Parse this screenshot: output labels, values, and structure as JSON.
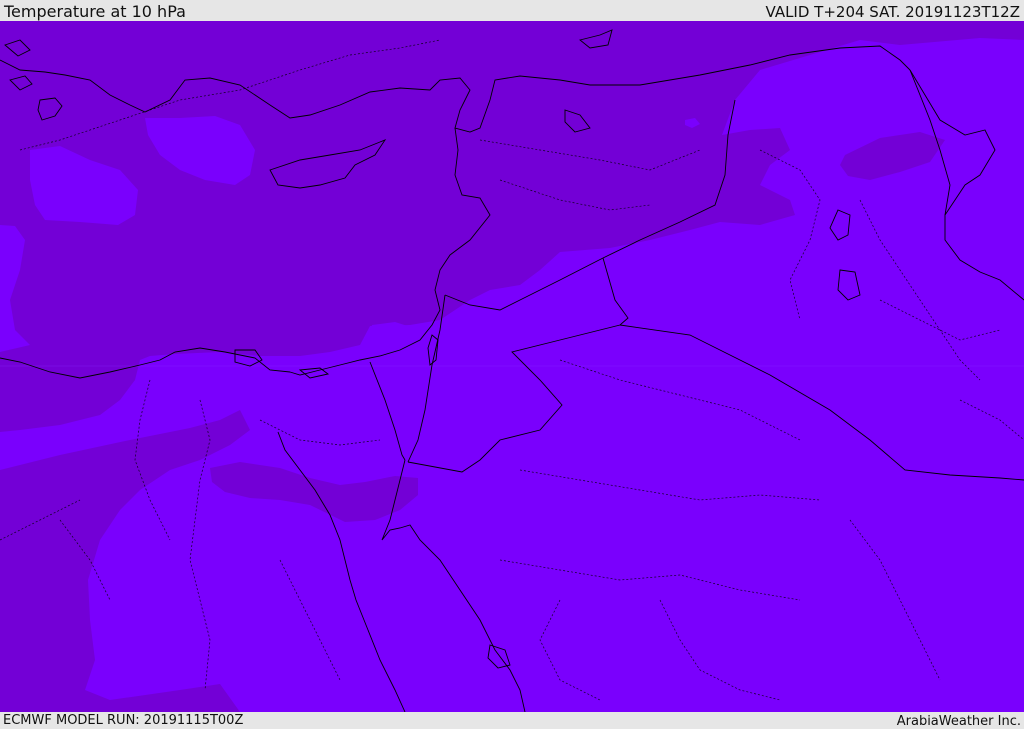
{
  "header": {
    "title": "Temperature at 10 hPa",
    "valid_time": "VALID T+204 SAT. 20191123T12Z"
  },
  "footer": {
    "model_run": "ECMWF MODEL RUN: 20191115T00Z",
    "credit": "ArabiaWeather Inc."
  },
  "map": {
    "colors": {
      "colder_zone": "#7300d6",
      "warmer_zone": "#7a00fd",
      "border_line": "#000000"
    }
  }
}
